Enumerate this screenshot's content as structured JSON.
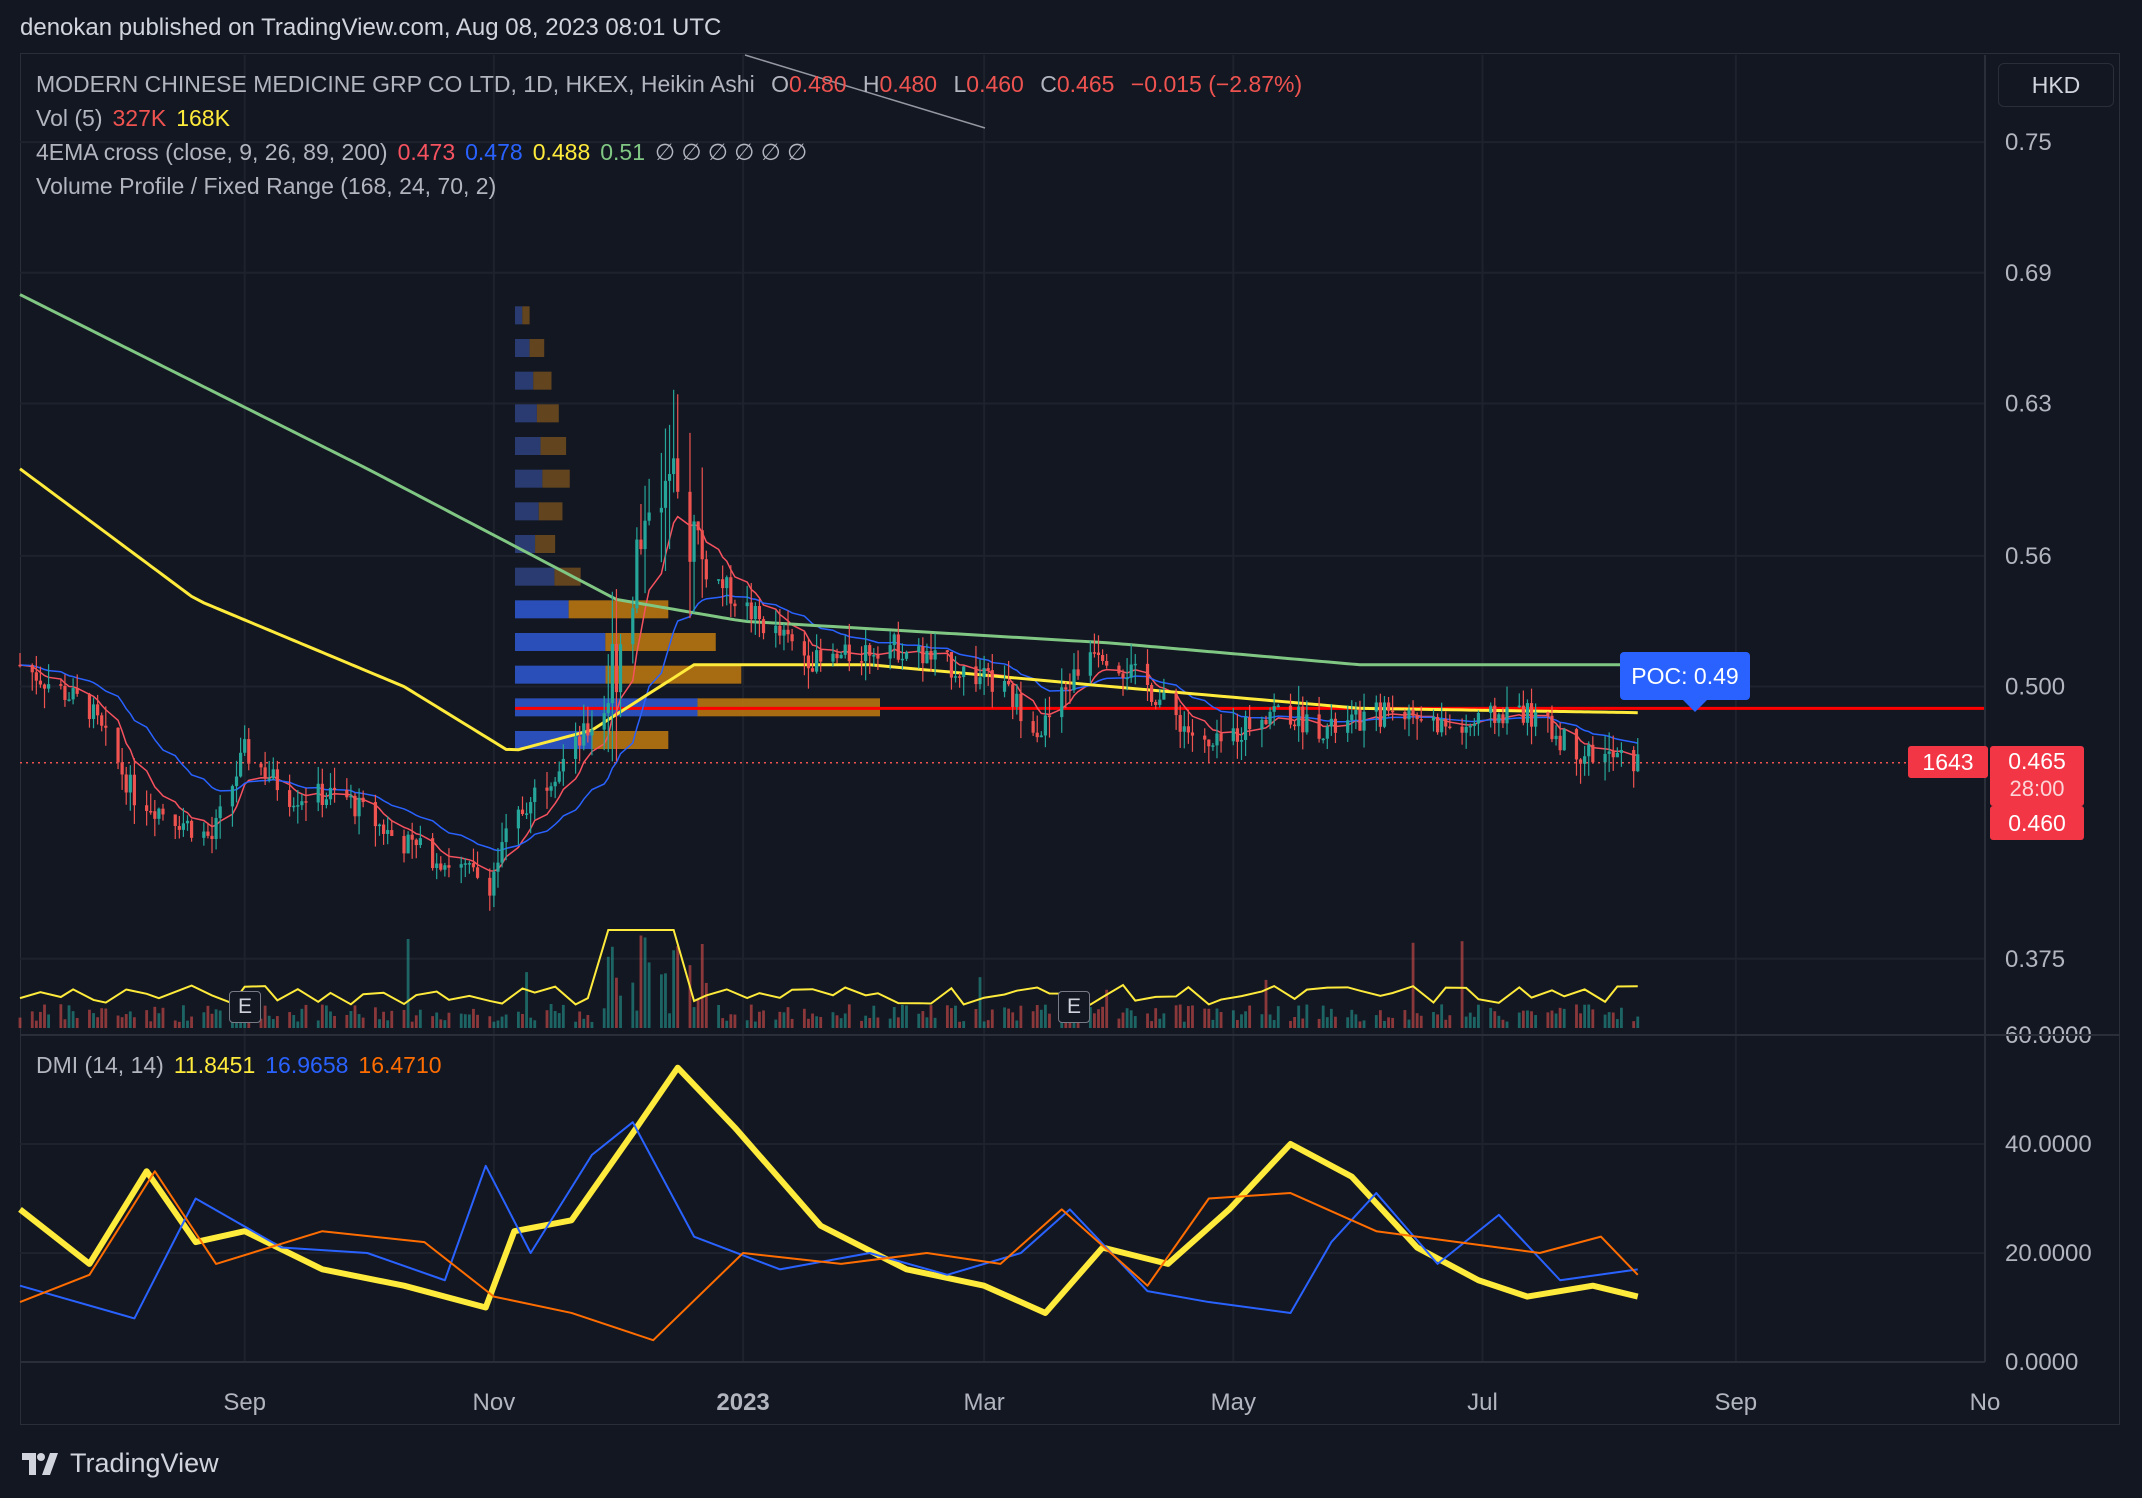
{
  "header": {
    "publish_text": "denokan published on TradingView.com, Aug 08, 2023 08:01 UTC"
  },
  "legend": {
    "symbol": "MODERN CHINESE MEDICINE GRP CO LTD, 1D, HKEX, Heikin Ashi",
    "ohlc": {
      "o_label": "O",
      "o": "0.480",
      "h_label": "H",
      "h": "0.480",
      "l_label": "L",
      "l": "0.460",
      "c_label": "C",
      "c": "0.465",
      "change": "−0.015 (−2.87%)"
    },
    "vol_label": "Vol (5)",
    "vol_1": "327K",
    "vol_2": "168K",
    "ema_label": "4EMA cross (close, 9, 26, 89, 200)",
    "ema_1": "0.473",
    "ema_2": "0.478",
    "ema_3": "0.488",
    "ema_4": "0.51",
    "ema_na": "∅ ∅ ∅ ∅ ∅ ∅",
    "vp_label": "Volume Profile / Fixed Range (168, 24, 70, 2)",
    "dmi_label": "DMI (14, 14)",
    "dmi_1": "11.8451",
    "dmi_2": "16.9658",
    "dmi_3": "16.4710"
  },
  "currency": "HKD",
  "poc_label": "POC: 0.49",
  "price_tags": {
    "countdown": "1643",
    "last": "0.465",
    "timer": "28:00",
    "low": "0.460"
  },
  "earnings_label": "E",
  "footer": {
    "brand": "TradingView"
  },
  "colors": {
    "up": "#26a69a",
    "down": "#ef5350",
    "ema9": "#f7525f",
    "ema26": "#2962ff",
    "ema89": "#ffeb3b",
    "ema200": "#81c784",
    "poc": "#ff0000",
    "dmi_adx": "#ffeb3b",
    "dmi_plus": "#2962ff",
    "dmi_minus": "#ff6d00"
  },
  "chart_data": [
    {
      "type": "candlestick",
      "title": "MODERN CHINESE MEDICINE GRP CO LTD, 1D, HKEX, Heikin Ashi",
      "x_ticks": [
        "Sep",
        "Nov",
        "2023",
        "Mar",
        "May",
        "Jul",
        "Sep",
        "No"
      ],
      "y_ticks": [
        "0.75",
        "0.69",
        "0.63",
        "0.56",
        "0.500",
        "0.375"
      ],
      "ylim": [
        0.34,
        0.79
      ],
      "x_range": [
        "2022-07-08",
        "2023-11-01"
      ],
      "close_path": [
        [
          "2022-07-08",
          0.51
        ],
        [
          "2022-07-25",
          0.49
        ],
        [
          "2022-08-05",
          0.45
        ],
        [
          "2022-08-15",
          0.44
        ],
        [
          "2022-08-24",
          0.43
        ],
        [
          "2022-09-01",
          0.47
        ],
        [
          "2022-09-12",
          0.45
        ],
        [
          "2022-09-25",
          0.45
        ],
        [
          "2022-10-08",
          0.43
        ],
        [
          "2022-10-20",
          0.42
        ],
        [
          "2022-10-31",
          0.41
        ],
        [
          "2022-11-04",
          0.43
        ],
        [
          "2022-11-10",
          0.45
        ],
        [
          "2022-11-20",
          0.47
        ],
        [
          "2022-11-28",
          0.49
        ],
        [
          "2022-12-05",
          0.55
        ],
        [
          "2022-12-10",
          0.6
        ],
        [
          "2022-12-17",
          0.58
        ],
        [
          "2022-12-25",
          0.55
        ],
        [
          "2023-01-05",
          0.53
        ],
        [
          "2023-01-20",
          0.51
        ],
        [
          "2023-02-05",
          0.52
        ],
        [
          "2023-02-20",
          0.51
        ],
        [
          "2023-03-05",
          0.5
        ],
        [
          "2023-03-15",
          0.48
        ],
        [
          "2023-03-28",
          0.52
        ],
        [
          "2023-04-10",
          0.5
        ],
        [
          "2023-04-25",
          0.47
        ],
        [
          "2023-05-10",
          0.49
        ],
        [
          "2023-05-25",
          0.48
        ],
        [
          "2023-06-10",
          0.49
        ],
        [
          "2023-06-25",
          0.48
        ],
        [
          "2023-07-10",
          0.49
        ],
        [
          "2023-07-25",
          0.47
        ],
        [
          "2023-08-08",
          0.465
        ]
      ],
      "ema200_path": [
        [
          "2022-07-08",
          0.68
        ],
        [
          "2022-10-01",
          0.6
        ],
        [
          "2022-12-01",
          0.54
        ],
        [
          "2023-01-01",
          0.53
        ],
        [
          "2023-04-01",
          0.52
        ],
        [
          "2023-06-01",
          0.51
        ],
        [
          "2023-08-08",
          0.51
        ]
      ],
      "ema89_path": [
        [
          "2022-07-08",
          0.6
        ],
        [
          "2022-08-20",
          0.54
        ],
        [
          "2022-10-10",
          0.5
        ],
        [
          "2022-11-05",
          0.47
        ],
        [
          "2022-11-25",
          0.48
        ],
        [
          "2022-12-20",
          0.51
        ],
        [
          "2023-02-01",
          0.51
        ],
        [
          "2023-04-01",
          0.5
        ],
        [
          "2023-06-01",
          0.49
        ],
        [
          "2023-08-08",
          0.488
        ]
      ],
      "poc": 0.49,
      "last": 0.465,
      "volume_profile_rows": [
        0.67,
        0.655,
        0.64,
        0.625,
        0.61,
        0.595,
        0.58,
        0.565,
        0.55,
        0.535,
        0.52,
        0.505,
        0.49,
        0.475
      ],
      "volume_profile_widths": [
        0.04,
        0.08,
        0.1,
        0.12,
        0.14,
        0.15,
        0.13,
        0.11,
        0.18,
        0.42,
        0.55,
        0.62,
        1.0,
        0.42
      ],
      "volume_profile_up_share": [
        0.5,
        0.5,
        0.5,
        0.5,
        0.5,
        0.5,
        0.5,
        0.5,
        0.6,
        0.35,
        0.45,
        0.4,
        0.5,
        0.5
      ],
      "earnings_dates": [
        "2022-08-28",
        "2023-03-21"
      ]
    },
    {
      "type": "line",
      "title": "DMI (14, 14)",
      "x_ticks": [
        "Sep",
        "Nov",
        "2023",
        "Mar",
        "May",
        "Jul",
        "Sep",
        "No"
      ],
      "y_ticks": [
        "60.0000",
        "40.0000",
        "20.0000",
        "0.0000"
      ],
      "ylim": [
        0,
        60
      ],
      "series": [
        {
          "color": "#ffeb3b",
          "points": [
            [
              "2022-07-08",
              28
            ],
            [
              "2022-07-25",
              18
            ],
            [
              "2022-08-08",
              35
            ],
            [
              "2022-08-20",
              22
            ],
            [
              "2022-09-01",
              24
            ],
            [
              "2022-09-20",
              17
            ],
            [
              "2022-10-10",
              14
            ],
            [
              "2022-10-30",
              10
            ],
            [
              "2022-11-06",
              24
            ],
            [
              "2022-11-20",
              26
            ],
            [
              "2022-12-05",
              42
            ],
            [
              "2022-12-16",
              54
            ],
            [
              "2022-12-30",
              43
            ],
            [
              "2023-01-20",
              25
            ],
            [
              "2023-02-10",
              17
            ],
            [
              "2023-03-01",
              14
            ],
            [
              "2023-03-16",
              9
            ],
            [
              "2023-03-30",
              21
            ],
            [
              "2023-04-15",
              18
            ],
            [
              "2023-04-30",
              28
            ],
            [
              "2023-05-15",
              40
            ],
            [
              "2023-05-30",
              34
            ],
            [
              "2023-06-15",
              21
            ],
            [
              "2023-06-30",
              15
            ],
            [
              "2023-07-12",
              12
            ],
            [
              "2023-07-28",
              14
            ],
            [
              "2023-08-08",
              12
            ]
          ]
        },
        {
          "color": "#2962ff",
          "points": [
            [
              "2022-07-08",
              14
            ],
            [
              "2022-08-05",
              8
            ],
            [
              "2022-08-20",
              30
            ],
            [
              "2022-09-10",
              21
            ],
            [
              "2022-10-01",
              20
            ],
            [
              "2022-10-20",
              15
            ],
            [
              "2022-10-30",
              36
            ],
            [
              "2022-11-10",
              20
            ],
            [
              "2022-11-25",
              38
            ],
            [
              "2022-12-05",
              44
            ],
            [
              "2022-12-20",
              23
            ],
            [
              "2023-01-10",
              17
            ],
            [
              "2023-02-01",
              20
            ],
            [
              "2023-02-20",
              16
            ],
            [
              "2023-03-10",
              20
            ],
            [
              "2023-03-22",
              28
            ],
            [
              "2023-04-10",
              13
            ],
            [
              "2023-04-25",
              11
            ],
            [
              "2023-05-15",
              9
            ],
            [
              "2023-05-25",
              22
            ],
            [
              "2023-06-05",
              31
            ],
            [
              "2023-06-20",
              18
            ],
            [
              "2023-07-05",
              27
            ],
            [
              "2023-07-20",
              15
            ],
            [
              "2023-08-08",
              17
            ]
          ]
        },
        {
          "color": "#ff6d00",
          "points": [
            [
              "2022-07-08",
              11
            ],
            [
              "2022-07-25",
              16
            ],
            [
              "2022-08-10",
              35
            ],
            [
              "2022-08-25",
              18
            ],
            [
              "2022-09-20",
              24
            ],
            [
              "2022-10-15",
              22
            ],
            [
              "2022-11-01",
              12
            ],
            [
              "2022-11-20",
              9
            ],
            [
              "2022-12-10",
              4
            ],
            [
              "2023-01-01",
              20
            ],
            [
              "2023-01-25",
              18
            ],
            [
              "2023-02-15",
              20
            ],
            [
              "2023-03-05",
              18
            ],
            [
              "2023-03-20",
              28
            ],
            [
              "2023-04-10",
              14
            ],
            [
              "2023-04-25",
              30
            ],
            [
              "2023-05-15",
              31
            ],
            [
              "2023-06-05",
              24
            ],
            [
              "2023-06-25",
              22
            ],
            [
              "2023-07-15",
              20
            ],
            [
              "2023-07-30",
              23
            ],
            [
              "2023-08-08",
              16
            ]
          ]
        }
      ]
    }
  ]
}
